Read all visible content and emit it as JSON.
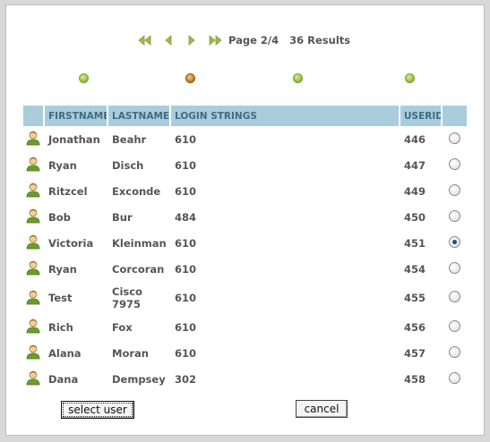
{
  "pager": {
    "page_text": "Page 2/4",
    "results_text": "36 Results",
    "nav_icons": [
      "first-page-icon",
      "previous-page-icon",
      "next-page-icon",
      "last-page-icon"
    ]
  },
  "page_dots": [
    {
      "state": "inactive",
      "color": "#9bc24a"
    },
    {
      "state": "active",
      "color": "#c48a2c"
    },
    {
      "state": "inactive",
      "color": "#9bc24a"
    },
    {
      "state": "inactive",
      "color": "#9bc24a"
    }
  ],
  "table": {
    "columns": [
      "",
      "FIRSTNAME",
      "LASTNAME",
      "LOGIN STRINGS",
      "USERID",
      ""
    ],
    "header_color": "#a9cddd",
    "rows": [
      {
        "first": "Jonathan",
        "last": "Beahr",
        "login": "610",
        "userid": "446",
        "selected": false
      },
      {
        "first": "Ryan",
        "last": "Disch",
        "login": "610",
        "userid": "447",
        "selected": false
      },
      {
        "first": "Ritzcel",
        "last": "Exconde",
        "login": "610",
        "userid": "449",
        "selected": false
      },
      {
        "first": "Bob",
        "last": "Bur",
        "login": "484",
        "userid": "450",
        "selected": false
      },
      {
        "first": "Victoria",
        "last": "Kleinman",
        "login": "610",
        "userid": "451",
        "selected": true
      },
      {
        "first": "Ryan",
        "last": "Corcoran",
        "login": "610",
        "userid": "454",
        "selected": false
      },
      {
        "first": "Test",
        "last": "Cisco 7975",
        "login": "610",
        "userid": "455",
        "selected": false
      },
      {
        "first": "Rich",
        "last": "Fox",
        "login": "610",
        "userid": "456",
        "selected": false
      },
      {
        "first": "Alana",
        "last": "Moran",
        "login": "610",
        "userid": "457",
        "selected": false
      },
      {
        "first": "Dana",
        "last": "Dempsey",
        "login": "302",
        "userid": "458",
        "selected": false
      }
    ]
  },
  "buttons": {
    "select_user": "select user",
    "cancel": "cancel"
  }
}
